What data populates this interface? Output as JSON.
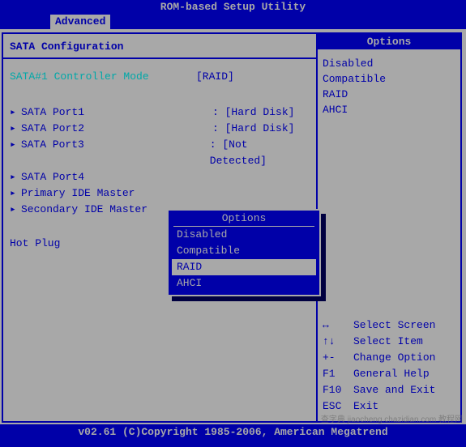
{
  "title": "ROM-based Setup Utility",
  "tab": "Advanced",
  "section": "SATA Configuration",
  "controller": {
    "label": "SATA#1 Controller Mode",
    "value": "[RAID]"
  },
  "ports": [
    {
      "label": "SATA Port1",
      "value": ": [Hard Disk]"
    },
    {
      "label": "SATA Port2",
      "value": ": [Hard Disk]"
    },
    {
      "label": "SATA Port3",
      "value": ": [Not Detected]"
    },
    {
      "label": "SATA Port4",
      "value": ""
    },
    {
      "label": "Primary IDE Master",
      "value": ""
    },
    {
      "label": "Secondary IDE Master",
      "value": ""
    }
  ],
  "hotplug": "Hot Plug",
  "popup": {
    "title": "Options",
    "items": [
      "Disabled",
      "Compatible",
      "RAID",
      "AHCI"
    ],
    "selected": 2
  },
  "help": {
    "title": "Options",
    "items": [
      "Disabled",
      "Compatible",
      "RAID",
      "AHCI"
    ]
  },
  "keys": [
    {
      "sym": "↔",
      "desc": "Select Screen"
    },
    {
      "sym": "↑↓",
      "desc": "Select Item"
    },
    {
      "sym": "+-",
      "desc": "Change Option"
    },
    {
      "sym": "F1",
      "desc": "General Help"
    },
    {
      "sym": "F10",
      "desc": "Save and Exit"
    },
    {
      "sym": "ESC",
      "desc": "Exit"
    }
  ],
  "footer": "v02.61 (C)Copyright 1985-2006, American Megatrend",
  "watermark": "查字典 jiaocheng.chazidian.com 教程网"
}
